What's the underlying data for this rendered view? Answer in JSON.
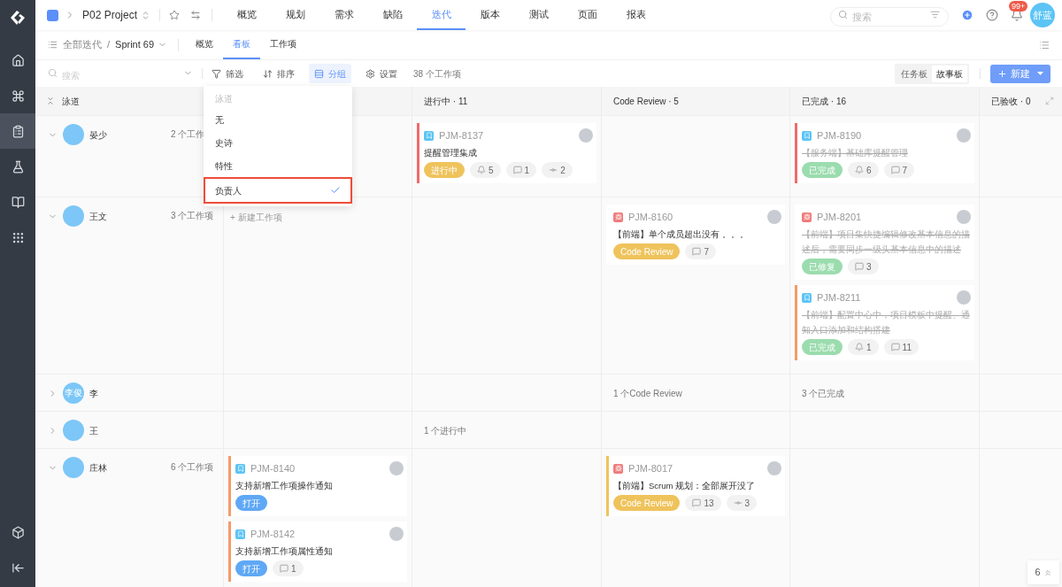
{
  "top_nav": {
    "project": "P02 Project",
    "tabs": [
      {
        "label": "概览",
        "selected": false
      },
      {
        "label": "规划",
        "selected": false
      },
      {
        "label": "需求",
        "selected": false
      },
      {
        "label": "缺陷",
        "selected": false
      },
      {
        "label": "迭代",
        "selected": true
      },
      {
        "label": "版本",
        "selected": false
      },
      {
        "label": "测试",
        "selected": false
      },
      {
        "label": "页面",
        "selected": false
      },
      {
        "label": "报表",
        "selected": false
      }
    ],
    "search": {
      "placeholder": "搜索"
    },
    "notification_badge": "99+",
    "user_avatar": "舒蓝"
  },
  "sidebar": {
    "items": [
      {
        "kind": "home",
        "selected": false
      },
      {
        "kind": "apps",
        "selected": false
      },
      {
        "kind": "document",
        "selected": true
      },
      {
        "kind": "flask",
        "selected": false
      },
      {
        "kind": "book",
        "selected": false
      },
      {
        "kind": "grid",
        "selected": false
      }
    ],
    "bottom_items": [
      {
        "kind": "cube"
      },
      {
        "kind": "collapse"
      }
    ]
  },
  "sub_nav": {
    "breadcrumb": "全部迭代",
    "separator": "/",
    "sprint": "Sprint 69",
    "tabs": [
      {
        "label": "概览",
        "selected": false
      },
      {
        "label": "看板",
        "selected": true
      },
      {
        "label": "工作项",
        "selected": false
      }
    ]
  },
  "toolbar": {
    "search": {
      "placeholder": "搜索"
    },
    "actions": [
      {
        "kind": "filter",
        "label": "筛选",
        "active": false
      },
      {
        "kind": "sort",
        "label": "排序",
        "active": false
      },
      {
        "kind": "group",
        "label": "分组",
        "active": true
      },
      {
        "kind": "settings",
        "label": "设置",
        "active": false
      }
    ],
    "count": "38 个工作项",
    "board_toggle": [
      {
        "label": "任务板",
        "selected": false
      },
      {
        "label": "故事板",
        "selected": true
      }
    ],
    "new_button": "新建"
  },
  "group_menu": {
    "header": "泳道",
    "items": [
      {
        "label": "无",
        "selected": false
      },
      {
        "label": "史诗",
        "selected": false
      },
      {
        "label": "特性",
        "selected": false
      },
      {
        "label": "负责人",
        "selected": true
      }
    ]
  },
  "board": {
    "lane_header": "泳道",
    "columns": [
      {
        "label": "进行中 · 11"
      },
      {
        "label": "Code Review · 5"
      },
      {
        "label": "已完成 · 16"
      },
      {
        "label": "已验收 · 0"
      }
    ],
    "lanes": [
      {
        "name": "晏少",
        "expanded": true,
        "count": "2 个工作",
        "cells": [
          {},
          {
            "cards": [
              {
                "id": "PJM-8137",
                "kind": "story",
                "title": "提醒管理集成",
                "done": false,
                "color": "#ef6b6b",
                "status": {
                  "label": "进行中",
                  "color": "#efc35c"
                },
                "stats": [
                  {
                    "kind": "watchers",
                    "value": "5"
                  },
                  {
                    "kind": "comments",
                    "value": "1"
                  },
                  {
                    "kind": "commits",
                    "value": "2"
                  }
                ]
              }
            ]
          },
          {},
          {
            "cards": [
              {
                "id": "PJM-8190",
                "kind": "story",
                "title": "【服务端】基础库提醒管理",
                "done": true,
                "color": "#ef6b6b",
                "status": {
                  "label": "已完成",
                  "color": "#9bdcae"
                },
                "stats": [
                  {
                    "kind": "watchers",
                    "value": "6"
                  },
                  {
                    "kind": "comments",
                    "value": "7"
                  }
                ]
              }
            ]
          },
          {}
        ]
      },
      {
        "name": "王文",
        "expanded": true,
        "count": "3 个工作项",
        "cells": [
          {
            "add": "+ 新建工作项"
          },
          {},
          {
            "cards": [
              {
                "id": "PJM-8160",
                "kind": "bug",
                "title": "【前端】单个成员超出没有 。。。",
                "done": false,
                "status": {
                  "label": "Code Review",
                  "color": "#efc35c"
                },
                "stats": [
                  {
                    "kind": "comments",
                    "value": "7"
                  }
                ]
              }
            ]
          },
          {
            "cards": [
              {
                "id": "PJM-8201",
                "kind": "bug",
                "title": "【前端】项目集快捷编辑修改基本信息的描述后，需要同步一级头基本信息中的描述",
                "done": true,
                "status": {
                  "label": "已修复",
                  "color": "#9bdcae"
                },
                "stats": [
                  {
                    "kind": "comments",
                    "value": "3"
                  }
                ]
              },
              {
                "id": "PJM-8211",
                "kind": "story",
                "title": "【前端】配置中心中，项目模板中提醒、通知入口添加和结构搭建",
                "done": true,
                "color": "#f59a6a",
                "status": {
                  "label": "已完成",
                  "color": "#9bdcae"
                },
                "stats": [
                  {
                    "kind": "watchers",
                    "value": "1"
                  },
                  {
                    "kind": "comments",
                    "value": "11"
                  }
                ]
              }
            ]
          },
          {}
        ]
      },
      {
        "name": "李",
        "expanded": false,
        "avatar_text": "李俊",
        "cells": [
          {},
          {},
          {
            "summary": "1 个Code Review"
          },
          {
            "summary": "3 个已完成"
          },
          {}
        ]
      },
      {
        "name": "王",
        "expanded": false,
        "cells": [
          {},
          {
            "summary": "1 个进行中"
          },
          {},
          {},
          {}
        ]
      },
      {
        "name": "庄林",
        "expanded": true,
        "count": "6 个工作项",
        "cells": [
          {
            "cards": [
              {
                "id": "PJM-8140",
                "kind": "story",
                "title": "支持新增工作项操作通知",
                "done": false,
                "color": "#f59a6a",
                "status": {
                  "label": "打开",
                  "color": "#5fa8f5"
                }
              },
              {
                "id": "PJM-8142",
                "kind": "story",
                "title": "支持新增工作项属性通知",
                "done": false,
                "color": "#f59a6a",
                "status": {
                  "label": "打开",
                  "color": "#5fa8f5"
                },
                "stats": [
                  {
                    "kind": "comments",
                    "value": "1"
                  }
                ]
              }
            ]
          },
          {},
          {
            "cards": [
              {
                "id": "PJM-8017",
                "kind": "bug",
                "title": "【前端】Scrum 规划：全部展开没了",
                "done": false,
                "color": "#f0c45a",
                "status": {
                  "label": "Code Review",
                  "color": "#efc35c"
                },
                "stats": [
                  {
                    "kind": "comments",
                    "value": "13"
                  },
                  {
                    "kind": "commits",
                    "value": "3"
                  }
                ]
              }
            ]
          },
          {},
          {}
        ]
      }
    ]
  },
  "back_to_top": {
    "count": "6"
  }
}
